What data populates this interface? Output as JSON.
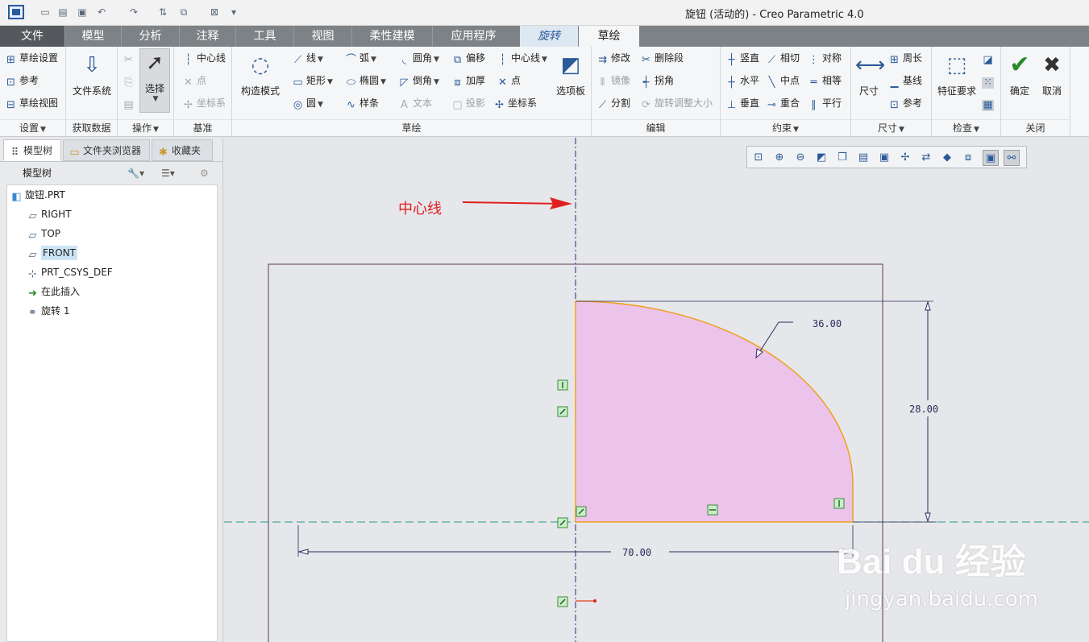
{
  "title": "旋钮 (活动的) - Creo Parametric 4.0",
  "tabs": [
    "文件",
    "模型",
    "分析",
    "注释",
    "工具",
    "视图",
    "柔性建模",
    "应用程序",
    "旋转",
    "草绘"
  ],
  "groups": {
    "setup": "设置",
    "getdata": "获取数据",
    "ops": "操作",
    "datum": "基准",
    "sketch": "草绘",
    "edit": "编辑",
    "constrain": "约束",
    "dim": "尺寸",
    "inspect": "检查",
    "close": "关闭"
  },
  "ribbon": {
    "setup": [
      "草绘设置",
      "参考",
      "草绘视图"
    ],
    "filesys": "文件系统",
    "select": "选择",
    "datum": [
      "中心线",
      "点",
      "坐标系"
    ],
    "construct": "构造模式",
    "sk": [
      "线",
      "弧",
      "圆角",
      "偏移",
      "中心线",
      "矩形",
      "椭圆",
      "倒角",
      "加厚",
      "点",
      "圆",
      "样条",
      "文本",
      "投影",
      "坐标系"
    ],
    "palette": "选项板",
    "edit": [
      "修改",
      "删除段",
      "镜像",
      "拐角",
      "分割",
      "旋转调整大小"
    ],
    "cons": [
      "竖直",
      "相切",
      "对称",
      "水平",
      "中点",
      "相等",
      "垂直",
      "重合",
      "平行"
    ],
    "dim": [
      "尺寸",
      "周长",
      "基线",
      "参考"
    ],
    "inspect": "特征要求",
    "ok": "确定",
    "cancel": "取消"
  },
  "panel": {
    "tabs": [
      "模型树",
      "文件夹浏览器",
      "收藏夹"
    ],
    "header": "模型树",
    "tree": [
      "旋钮.PRT",
      "RIGHT",
      "TOP",
      "FRONT",
      "PRT_CSYS_DEF",
      "在此插入",
      "旋转 1"
    ]
  },
  "sketch": {
    "dims": [
      "36.00",
      "28.00",
      "70.00"
    ],
    "annotation": "中心线"
  },
  "watermark": {
    "logo": "Bai du 经验",
    "url": "jingyan.baidu.com"
  }
}
